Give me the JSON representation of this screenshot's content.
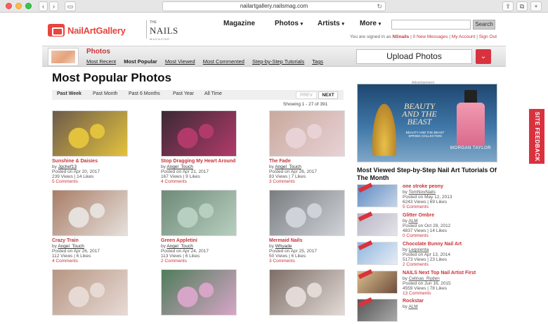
{
  "browser": {
    "url": "nailartgallery.nailsmag.com"
  },
  "header": {
    "logo_text": "NailArtGallery",
    "brand_the": "THE",
    "brand_name": "NAILS",
    "brand_sub": "MAGAZINE",
    "nav": {
      "magazine": "Magazine",
      "photos": "Photos",
      "artists": "Artists",
      "more": "More"
    },
    "search_button": "Search",
    "signed_in_prefix": "You are signed in as",
    "username": "NSnails",
    "messages": "0 New Messages",
    "my_account": "My Account",
    "sign_out": "Sign Out"
  },
  "subheader": {
    "title": "Photos",
    "nav": [
      "Most Recent",
      "Most Popular",
      "Most Viewed",
      "Most Commented",
      "Step-by-Step Tutorials",
      "Tags"
    ],
    "active_nav": "Most Popular",
    "upload_label": "Upload Photos"
  },
  "main": {
    "heading": "Most Popular Photos",
    "filters": [
      "Past Week",
      "Past Month",
      "Past 6 Months",
      "Past Year",
      "All Time"
    ],
    "active_filter": "Past Week",
    "prev": "PREV",
    "next": "NEXT",
    "showing": "Showing 1  -  27  of  391",
    "photos": [
      {
        "title": "Sunshine & Daisies",
        "by": "Jgchef13",
        "posted": "Posted on Apr 20, 2017",
        "stats": "239 Views  |  14 Likes",
        "comments": "5 Comments",
        "c1": "#6d5a4b",
        "c2": "#e3c23d"
      },
      {
        "title": "Stop Dragging My Heart Around",
        "by": "Angel_Touch",
        "posted": "Posted on Apr 21, 2017",
        "stats": "167 Views  |  9 Likes",
        "comments": "4 Comments",
        "c1": "#3a2a35",
        "c2": "#b23a6a"
      },
      {
        "title": "The Fade",
        "by": "Angel_Touch",
        "posted": "Posted on Apr 26, 2017",
        "stats": "83 Views  |  7 Likes",
        "comments": "3 Comments",
        "c1": "#c9a99e",
        "c2": "#e8d2d6"
      },
      {
        "title": "Crazy Train",
        "by": "Angel_Touch",
        "posted": "Posted on Apr 26, 2017",
        "stats": "112 Views  |  6 Likes",
        "comments": "4 Comments",
        "c1": "#a97d67",
        "c2": "#e6e1dc"
      },
      {
        "title": "Green Appletini",
        "by": "Angel_Touch",
        "posted": "Posted on Apr 24, 2017",
        "stats": "113 Views  |  6 Likes",
        "comments": "2 Comments",
        "c1": "#6f8a78",
        "c2": "#b7cfc0"
      },
      {
        "title": "Mermaid Nails",
        "by": "Whyade",
        "posted": "Posted on Apr 25, 2017",
        "stats": "50 Views  |  6 Likes",
        "comments": "3 Comments",
        "c1": "#7a7d80",
        "c2": "#cfd2d8"
      },
      {
        "title": "",
        "by": "",
        "posted": "",
        "stats": "",
        "comments": "",
        "c1": "#b79683",
        "c2": "#e7dad5"
      },
      {
        "title": "",
        "by": "",
        "posted": "",
        "stats": "",
        "comments": "",
        "c1": "#4f7d5a",
        "c2": "#d7a5c7"
      },
      {
        "title": "",
        "by": "",
        "posted": "",
        "stats": "",
        "comments": "",
        "c1": "#7d6e66",
        "c2": "#e3dad7"
      }
    ]
  },
  "sidebar": {
    "ad_label": "Advertisement",
    "ad_title": "BEAUTY AND THE BEAST",
    "ad_caption": "BEAUTY AND THE BEAST SPRING COLLECTION",
    "ad_brand": "MORGAN TAYLOR",
    "most_viewed_heading": "Most Viewed Step-by-Step Nail Art Tutorials Of The Month",
    "tutorials": [
      {
        "title": "one stroke peony",
        "by": "TomNovNails",
        "posted": "Posted on May 12, 2013",
        "stats": "6243 Views  |  69 Likes",
        "comments": "5 Comments",
        "c1": "#5d8bc4",
        "c2": "#c7d4e6"
      },
      {
        "title": "Glitter Ombre",
        "by": "ALM",
        "posted": "Posted on Oct 28, 2012",
        "stats": "4837 Views  |  14 Likes",
        "comments": "0 Comments",
        "c1": "#b7b6c4",
        "c2": "#e5e4ea"
      },
      {
        "title": "Chocolate Bunny Nail Art",
        "by": "Legoienta",
        "posted": "Posted on Apr 13, 2014",
        "stats": "5173 Views  |  23 Likes",
        "comments": "2 Comments",
        "c1": "#8fb7de",
        "c2": "#e7ecf5"
      },
      {
        "title": "NAILS Next Top Nail Artist First",
        "by": "Celinas_Ryden",
        "posted": "Posted on Jun 16, 2015",
        "stats": "4559 Views  |  78 Likes",
        "comments": "13 Comments",
        "c1": "#d9c08f",
        "c2": "#6e4c3c"
      },
      {
        "title": "Rockstar",
        "by": "ALM",
        "posted": "",
        "stats": "",
        "comments": "",
        "c1": "#555",
        "c2": "#aaa"
      }
    ]
  },
  "feedback_tab": "SITE FEEDBACK",
  "colors": {
    "accent": "#c8323a",
    "button": "#d9323f"
  }
}
